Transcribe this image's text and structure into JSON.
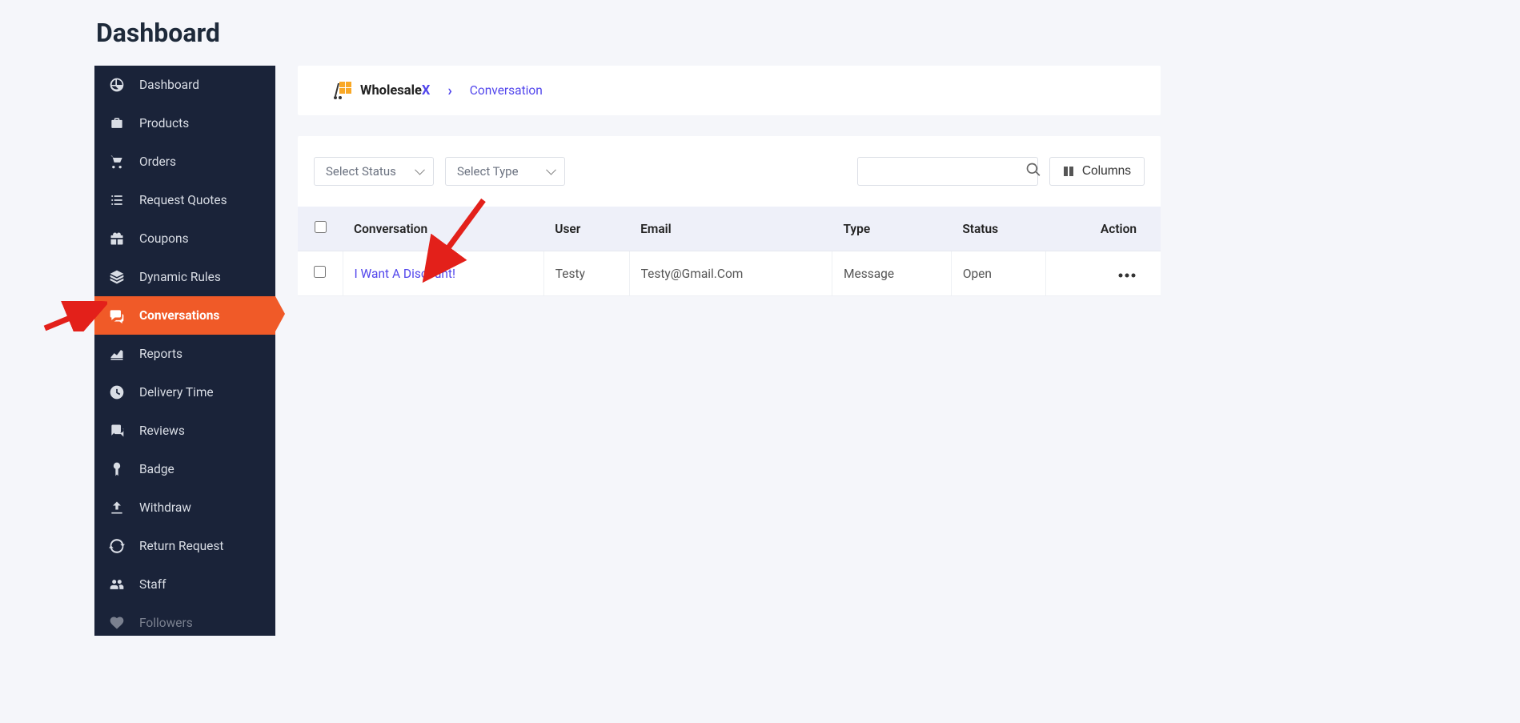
{
  "page_title": "Dashboard",
  "sidebar": {
    "items": [
      {
        "label": "Dashboard",
        "icon": "dashboard-icon",
        "active": false
      },
      {
        "label": "Products",
        "icon": "briefcase-icon",
        "active": false
      },
      {
        "label": "Orders",
        "icon": "cart-icon",
        "active": false
      },
      {
        "label": "Request Quotes",
        "icon": "list-icon",
        "active": false
      },
      {
        "label": "Coupons",
        "icon": "gift-icon",
        "active": false
      },
      {
        "label": "Dynamic Rules",
        "icon": "layers-icon",
        "active": false
      },
      {
        "label": "Conversations",
        "icon": "chat-icon",
        "active": true
      },
      {
        "label": "Reports",
        "icon": "chart-icon",
        "active": false
      },
      {
        "label": "Delivery Time",
        "icon": "clock-icon",
        "active": false
      },
      {
        "label": "Reviews",
        "icon": "comments-icon",
        "active": false
      },
      {
        "label": "Badge",
        "icon": "badge-icon",
        "active": false
      },
      {
        "label": "Withdraw",
        "icon": "upload-icon",
        "active": false
      },
      {
        "label": "Return Request",
        "icon": "refresh-icon",
        "active": false
      },
      {
        "label": "Staff",
        "icon": "users-icon",
        "active": false
      },
      {
        "label": "Followers",
        "icon": "heart-icon",
        "active": false
      }
    ]
  },
  "breadcrumb": {
    "brand_main": "Wholesale",
    "brand_suffix": "X",
    "current": "Conversation"
  },
  "toolbar": {
    "status_placeholder": "Select Status",
    "type_placeholder": "Select Type",
    "columns_label": "Columns",
    "search_value": ""
  },
  "table": {
    "headers": [
      "Conversation",
      "User",
      "Email",
      "Type",
      "Status",
      "Action"
    ],
    "rows": [
      {
        "conversation": "I Want A Discount!",
        "user": "Testy",
        "email": "Testy@Gmail.Com",
        "type": "Message",
        "status": "Open"
      }
    ]
  },
  "annotations": {
    "arrow1_target": "sidebar-conversations",
    "arrow2_target": "conversation-link"
  }
}
